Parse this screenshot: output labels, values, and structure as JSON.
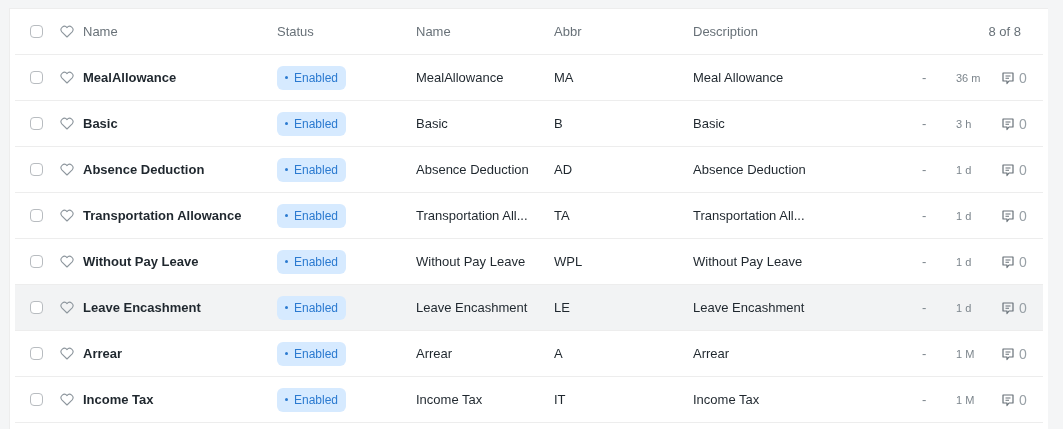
{
  "header": {
    "columns": [
      "Name",
      "Status",
      "Name",
      "Abbr",
      "Description"
    ],
    "count": "8 of 8",
    "checked": false
  },
  "rows": [
    {
      "name": "MealAllowance",
      "status": "Enabled",
      "name_2": "MealAllowance",
      "abbr": "MA",
      "description": "Meal Allowance",
      "dash": "-",
      "modified": "36 m",
      "comments": "0",
      "checked": false,
      "liked": false,
      "highlighted": false
    },
    {
      "name": "Basic",
      "status": "Enabled",
      "name_2": "Basic",
      "abbr": "B",
      "description": "Basic",
      "dash": "-",
      "modified": "3 h",
      "comments": "0",
      "checked": false,
      "liked": false,
      "highlighted": false
    },
    {
      "name": "Absence Deduction",
      "status": "Enabled",
      "name_2": "Absence Deduction",
      "abbr": "AD",
      "description": "Absence Deduction",
      "dash": "-",
      "modified": "1 d",
      "comments": "0",
      "checked": false,
      "liked": false,
      "highlighted": false
    },
    {
      "name": "Transportation Allowance",
      "status": "Enabled",
      "name_2": "Transportation All...",
      "abbr": "TA",
      "description": "Transportation All...",
      "dash": "-",
      "modified": "1 d",
      "comments": "0",
      "checked": false,
      "liked": false,
      "highlighted": false
    },
    {
      "name": "Without Pay Leave",
      "status": "Enabled",
      "name_2": "Without Pay Leave",
      "abbr": "WPL",
      "description": "Without Pay Leave",
      "dash": "-",
      "modified": "1 d",
      "comments": "0",
      "checked": false,
      "liked": false,
      "highlighted": false
    },
    {
      "name": "Leave Encashment",
      "status": "Enabled",
      "name_2": "Leave Encashment",
      "abbr": "LE",
      "description": "Leave Encashment",
      "dash": "-",
      "modified": "1 d",
      "comments": "0",
      "checked": false,
      "liked": false,
      "highlighted": true
    },
    {
      "name": "Arrear",
      "status": "Enabled",
      "name_2": "Arrear",
      "abbr": "A",
      "description": "Arrear",
      "dash": "-",
      "modified": "1 M",
      "comments": "0",
      "checked": false,
      "liked": false,
      "highlighted": false
    },
    {
      "name": "Income Tax",
      "status": "Enabled",
      "name_2": "Income Tax",
      "abbr": "IT",
      "description": "Income Tax",
      "dash": "-",
      "modified": "1 M",
      "comments": "0",
      "checked": false,
      "liked": false,
      "highlighted": false
    }
  ]
}
